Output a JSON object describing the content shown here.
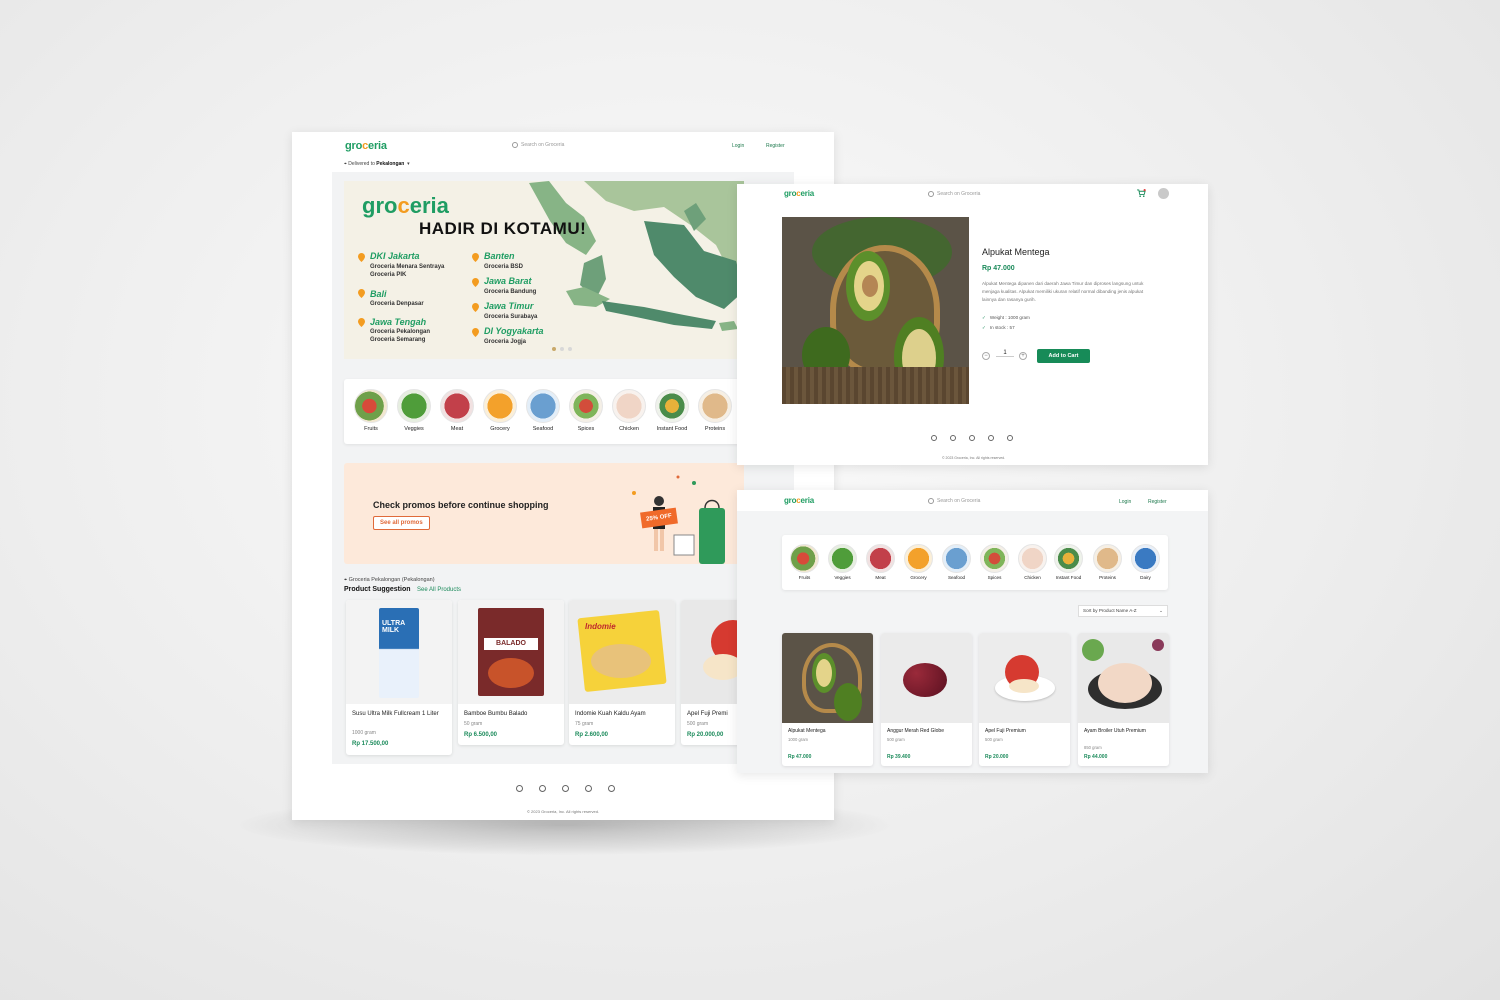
{
  "brand": {
    "name_a": "gro",
    "name_o": "c",
    "name_b": "eria"
  },
  "search_placeholder": "Search on Groceria",
  "auth": {
    "login": "Login",
    "register": "Register"
  },
  "home": {
    "delivered_prefix": "Delivered to",
    "delivered_city": "Pekalongan",
    "banner": {
      "headline": "HADIR DI KOTAMU!",
      "locations": [
        {
          "city": "DKI Jakarta",
          "stores": "Groceria Menara Sentraya\nGroceria PIK"
        },
        {
          "city": "Bali",
          "stores": "Groceria Denpasar"
        },
        {
          "city": "Jawa Tengah",
          "stores": "Groceria Pekalongan\nGroceria Semarang"
        },
        {
          "city": "Banten",
          "stores": "Groceria BSD"
        },
        {
          "city": "Jawa Barat",
          "stores": "Groceria Bandung"
        },
        {
          "city": "Jawa Timur",
          "stores": "Groceria Surabaya"
        },
        {
          "city": "DI Yogyakarta",
          "stores": "Groceria Jogja"
        }
      ]
    },
    "categories": [
      "Fruits",
      "Veggies",
      "Meat",
      "Grocery",
      "Seafood",
      "Spices",
      "Chicken",
      "Instant Food",
      "Proteins"
    ],
    "promo": {
      "title": "Check promos before continue shopping",
      "button": "See all promos",
      "tag": "25% OFF"
    },
    "store_label": "Groceria Pekalongan (Pekalongan)",
    "suggestion_title": "Product Suggestion",
    "see_all": "See All Products",
    "products": [
      {
        "name": "Susu Ultra Milk Fullcream 1 Liter",
        "weight": "1000 gram",
        "price": "Rp 17.500,00"
      },
      {
        "name": "Bamboe Bumbu Balado",
        "weight": "50 gram",
        "price": "Rp 6.500,00"
      },
      {
        "name": "Indomie Kuah Kaldu Ayam",
        "weight": "75 gram",
        "price": "Rp 2.600,00"
      },
      {
        "name": "Apel Fuji Premi",
        "weight": "500 gram",
        "price": "Rp 20.000,00"
      }
    ],
    "copyright": "© 2023 Groceria, Inc. All rights reserved."
  },
  "detail": {
    "name": "Alpukat Mentega",
    "price": "Rp 47.000",
    "description": "Alpukat Mentega dipanen dari daerah Jawa Timur dan diproses langsung untuk menjaga kualitas. Alpukat memiliki ukuran relatif normal dibanding jenis alpukat lainnya dan rasanya gurih.",
    "weight": "Weight : 1000 gram",
    "stock": "In stock : 57",
    "quantity": "1",
    "add_to_cart": "Add to Cart",
    "cart_count": "1",
    "copyright": "© 2023 Groceria, Inc. All rights reserved."
  },
  "listing": {
    "categories": [
      "Fruits",
      "Veggies",
      "Meat",
      "Grocery",
      "Seafood",
      "Spices",
      "Chicken",
      "Instant Food",
      "Proteins",
      "Dairy"
    ],
    "sort_label": "Sort by Product Name A-Z",
    "products": [
      {
        "name": "Alpukat Mentega",
        "weight": "1000 gram",
        "price": "Rp 47.000"
      },
      {
        "name": "Anggur Merah Red Globe",
        "weight": "500 gram",
        "price": "Rp 39.400"
      },
      {
        "name": "Apel Fuji Premium",
        "weight": "500 gram",
        "price": "Rp 20.000"
      },
      {
        "name": "Ayam Broiler Utuh Premium",
        "weight": "850 gram",
        "price": "Rp 44.000"
      }
    ]
  },
  "colors": {
    "brand_green": "#1f9d63",
    "brand_orange": "#f39c20",
    "price_green": "#1a8a5a",
    "promo_bg": "#fde9da"
  }
}
